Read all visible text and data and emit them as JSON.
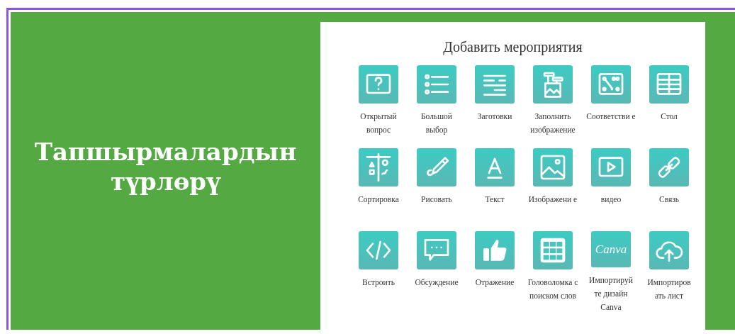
{
  "slide": {
    "heading": "Тапшырмалардын түрлөрү"
  },
  "panel": {
    "title": "Добавить мероприятия",
    "tiles": [
      {
        "label": "Открытый вопрос"
      },
      {
        "label": "Большой выбор"
      },
      {
        "label": "Заготовки"
      },
      {
        "label": "Заполнить изображение"
      },
      {
        "label": "Соответстви е"
      },
      {
        "label": "Стол"
      },
      {
        "label": "Сортировка"
      },
      {
        "label": "Рисовать"
      },
      {
        "label": "Текст"
      },
      {
        "label": "Изображени е"
      },
      {
        "label": "видео"
      },
      {
        "label": "Связь"
      },
      {
        "label": "Встроить"
      },
      {
        "label": "Обсуждение"
      },
      {
        "label": "Отражение"
      },
      {
        "label": "Головоломка с поиском слов"
      },
      {
        "logo_text": "Canva",
        "label": "Импортируй те дизайн Canva"
      },
      {
        "label": "Импортиров ать лист"
      }
    ]
  }
}
